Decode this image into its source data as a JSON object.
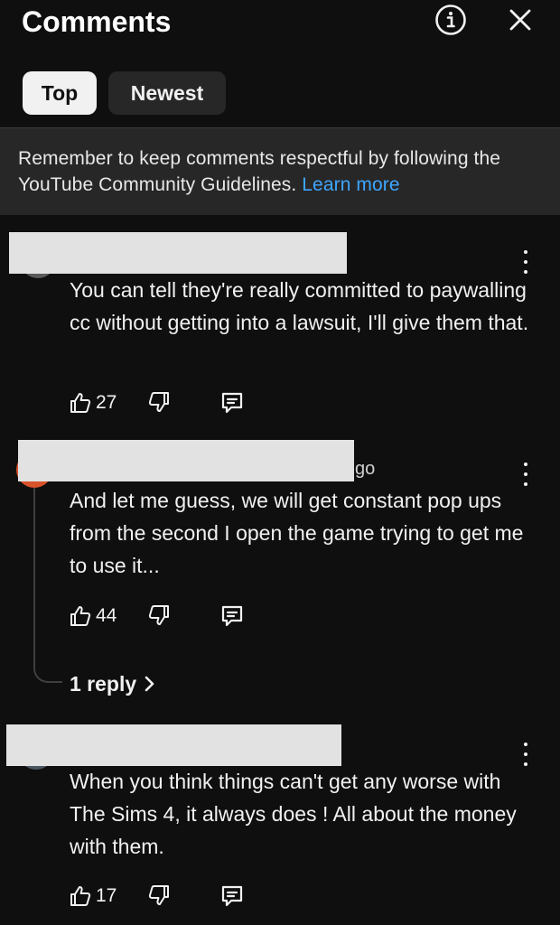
{
  "header": {
    "title": "Comments",
    "info_icon": "info-icon",
    "close_icon": "close-icon"
  },
  "tabs": [
    {
      "label": "Top",
      "selected": true
    },
    {
      "label": "Newest",
      "selected": false
    }
  ],
  "notice": {
    "text": "Remember to keep comments respectful by following the YouTube Community Guidelines.",
    "link": "Learn more"
  },
  "comments": [
    {
      "text": "You can tell they're really committed to paywalling cc without getting into a lawsuit, I'll give them that.",
      "likes": "27",
      "partial_meta": ""
    },
    {
      "text": "And let me guess, we will get constant pop ups from the second I open the game trying to get me to use it...",
      "likes": "44",
      "partial_meta": "go",
      "reply_label": "1 reply",
      "avatar_color": "#d9532b"
    },
    {
      "text": "When you think things can't get any worse with The Sims 4, it always does ! All about the money with them.",
      "likes": "17",
      "partial_meta": ""
    }
  ],
  "colors": {
    "background": "#0f0f0f",
    "notice_bg": "#272727",
    "link": "#3ea6ff",
    "chip_selected_bg": "#f1f1f1",
    "chip_bg": "#272727"
  }
}
